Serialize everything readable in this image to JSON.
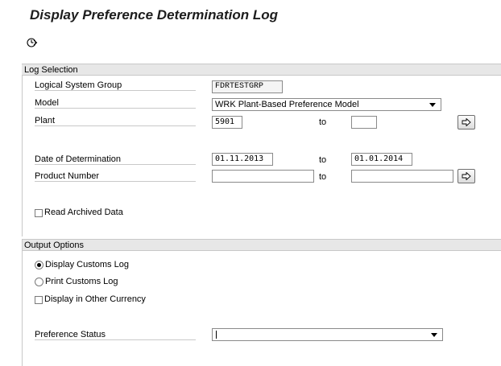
{
  "title": "Display Preference Determination Log",
  "toolbar": {
    "execute_icon": "execute-clock-icon"
  },
  "log_selection": {
    "header": "Log Selection",
    "logical_system_group": {
      "label": "Logical System Group",
      "value": "FDRTESTGRP"
    },
    "model": {
      "label": "Model",
      "value": "WRK Plant-Based Preference Model"
    },
    "plant": {
      "label": "Plant",
      "from": "5901",
      "to_label": "to",
      "to": ""
    },
    "date_of_determination": {
      "label": "Date of Determination",
      "from": "01.11.2013",
      "to_label": "to",
      "to": "01.01.2014"
    },
    "product_number": {
      "label": "Product Number",
      "from": "",
      "to_label": "to",
      "to": ""
    },
    "read_archived": {
      "label": "Read Archived Data",
      "checked": false
    }
  },
  "output_options": {
    "header": "Output Options",
    "display_customs_log": {
      "label": "Display Customs Log",
      "selected": true
    },
    "print_customs_log": {
      "label": "Print Customs Log",
      "selected": false
    },
    "display_other_currency": {
      "label": "Display in Other Currency",
      "checked": false
    },
    "preference_status": {
      "label": "Preference Status",
      "value": ""
    }
  }
}
